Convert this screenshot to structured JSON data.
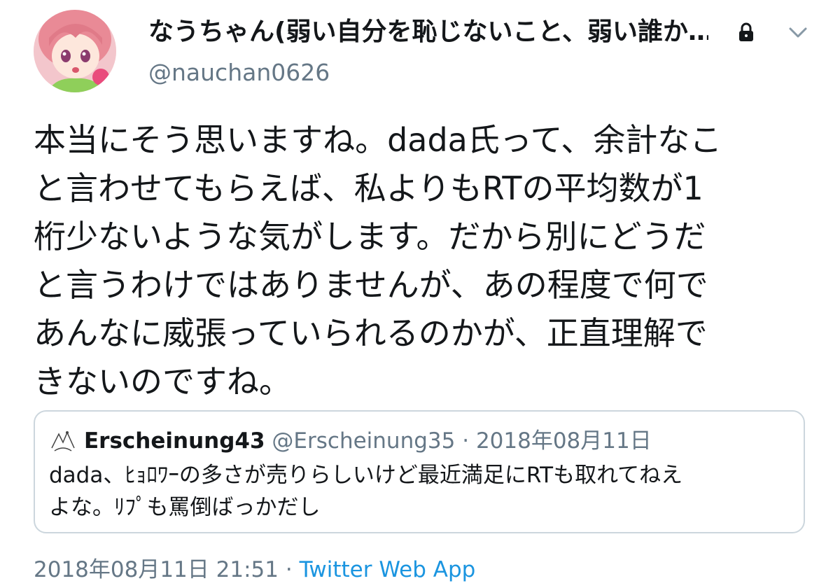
{
  "author": {
    "display_name": "なうちゃん(弱い自分を恥じないこと、弱い誰か…",
    "handle": "@nauchan0626"
  },
  "tweet": {
    "lines": [
      "本当にそう思いますね。dada氏って、余計なこ",
      "と言わせてもらえば、私よりもRTの平均数が1",
      "桁少ないような気がします。だから別にどうだ",
      "と言うわけではありませんが、あの程度で何で",
      "あんなに威張っていられるのかが、正直理解で",
      "きないのですね。"
    ]
  },
  "quoted_tweet": {
    "display_name": "Erscheinung43",
    "handle": "@Erscheinung35",
    "separator": "·",
    "date": "2018年08月11日",
    "lines": [
      "dada、ﾋｮﾛﾜｰの多さが売りらしいけど最近満足にRTも取れてねえ",
      "よな。ﾘﾌﾟも罵倒ばっかだし"
    ]
  },
  "footer": {
    "timestamp": "2018年08月11日 21:51",
    "separator": "·",
    "source": "Twitter Web App"
  },
  "icons": {
    "lock": "lock-icon",
    "chevron": "chevron-down-icon",
    "avatar": "avatar"
  },
  "colors": {
    "text": "#14171a",
    "secondary": "#657786",
    "link": "#1b95e0",
    "border": "#ccd6dd"
  }
}
